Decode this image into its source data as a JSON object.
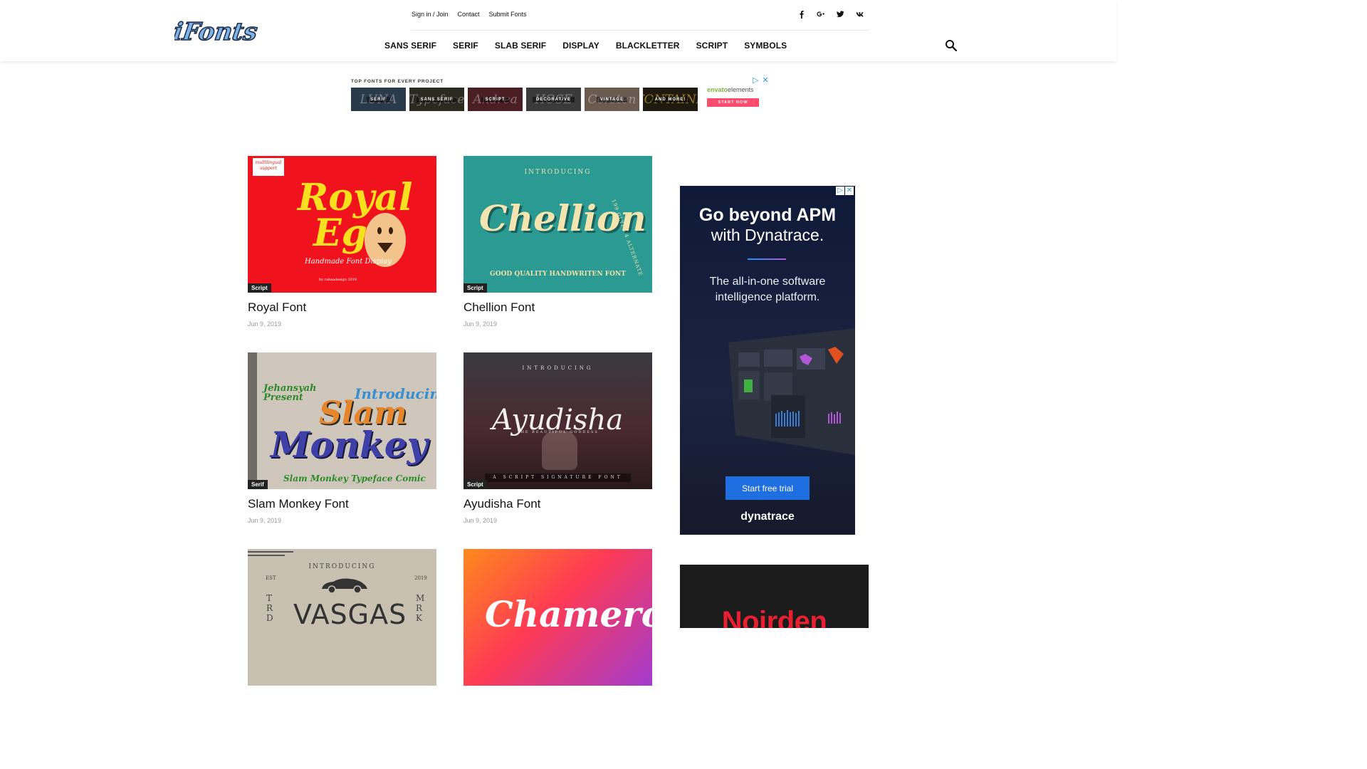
{
  "header": {
    "logo_text": "iFonts",
    "top_links": [
      "Sign in / Join",
      "Contact",
      "Submit Fonts"
    ],
    "social": [
      "facebook-icon",
      "google-plus-icon",
      "twitter-icon",
      "vk-icon"
    ],
    "nav": [
      "SANS SERIF",
      "SERIF",
      "SLAB SERIF",
      "DISPLAY",
      "BLACKLETTER",
      "SCRIPT",
      "SYMBOLS"
    ]
  },
  "ad_banner": {
    "headline": "TOP FONTS FOR EVERY PROJECT",
    "tiles": [
      {
        "label": "SERIF",
        "art": "LUNA"
      },
      {
        "label": "SANS SERIF",
        "art": "Typeface"
      },
      {
        "label": "SCRIPT",
        "art": "Andrea"
      },
      {
        "label": "DECORATIVE",
        "art": "HOSE"
      },
      {
        "label": "VINTAGE",
        "art": "Corsten"
      },
      {
        "label": "AND MORE!",
        "art": "FONTAINE"
      }
    ],
    "brand": "envato",
    "brand_suffix": "elements",
    "cta": "START NOW"
  },
  "posts": [
    {
      "title": "Royal Font",
      "date": "Jun 9, 2019",
      "category": "Script",
      "thumb": {
        "badge": "multilingual support",
        "line1": "Royal",
        "line2": "Egg",
        "tagline": "Handmade Font Display",
        "credit": "by rahaadesign 2019"
      }
    },
    {
      "title": "Chellion Font",
      "date": "Jun 9, 2019",
      "category": "Script",
      "thumb": {
        "top": "INTRODUCING",
        "word": "Chellion",
        "side": "199 GLYPS 4 ALTERNATE",
        "bottom": "GOOD QUALITY HANDWRITEN FONT"
      }
    },
    {
      "title": "Slam Monkey Font",
      "date": "Jun 9, 2019",
      "category": "Serif",
      "thumb": {
        "corner": "Jehansyah Present",
        "intro": "Introducing",
        "line1": "Slam",
        "line2": "Monkey",
        "bottom": "Slam Monkey Typeface Comic"
      }
    },
    {
      "title": "Ayudisha Font",
      "date": "Jun 9, 2019",
      "category": "Script",
      "thumb": {
        "top": "INTRODUCING",
        "word": "Ayudisha",
        "tag": "THE BEAUTIFUL GODDESS",
        "bottom": "A SCRIPT SIGNATURE FONT"
      }
    },
    {
      "title": "",
      "date": "",
      "category": "",
      "thumb": {
        "top": "INTRODUCING",
        "est": "EST",
        "year": "2019",
        "word": "VASGAS",
        "left_letters": "T R D",
        "right_letters": "M R K"
      }
    },
    {
      "title": "",
      "date": "",
      "category": "",
      "thumb": {
        "word": "Chameron"
      }
    }
  ],
  "sidebar": {
    "dynatrace": {
      "headline1": "Go beyond APM",
      "headline2": "with Dynatrace.",
      "sub": "The all-in-one software intelligence platform.",
      "cta": "Start free trial",
      "brand": "dynatrace"
    },
    "noirden": {
      "word": "Noirden"
    }
  },
  "colors": {
    "accent": "#111111",
    "category_bg": "#222222",
    "dynatrace_button": "#1f6fe0",
    "envato_green": "#82b541",
    "envato_cta": "#ff4b6e"
  }
}
